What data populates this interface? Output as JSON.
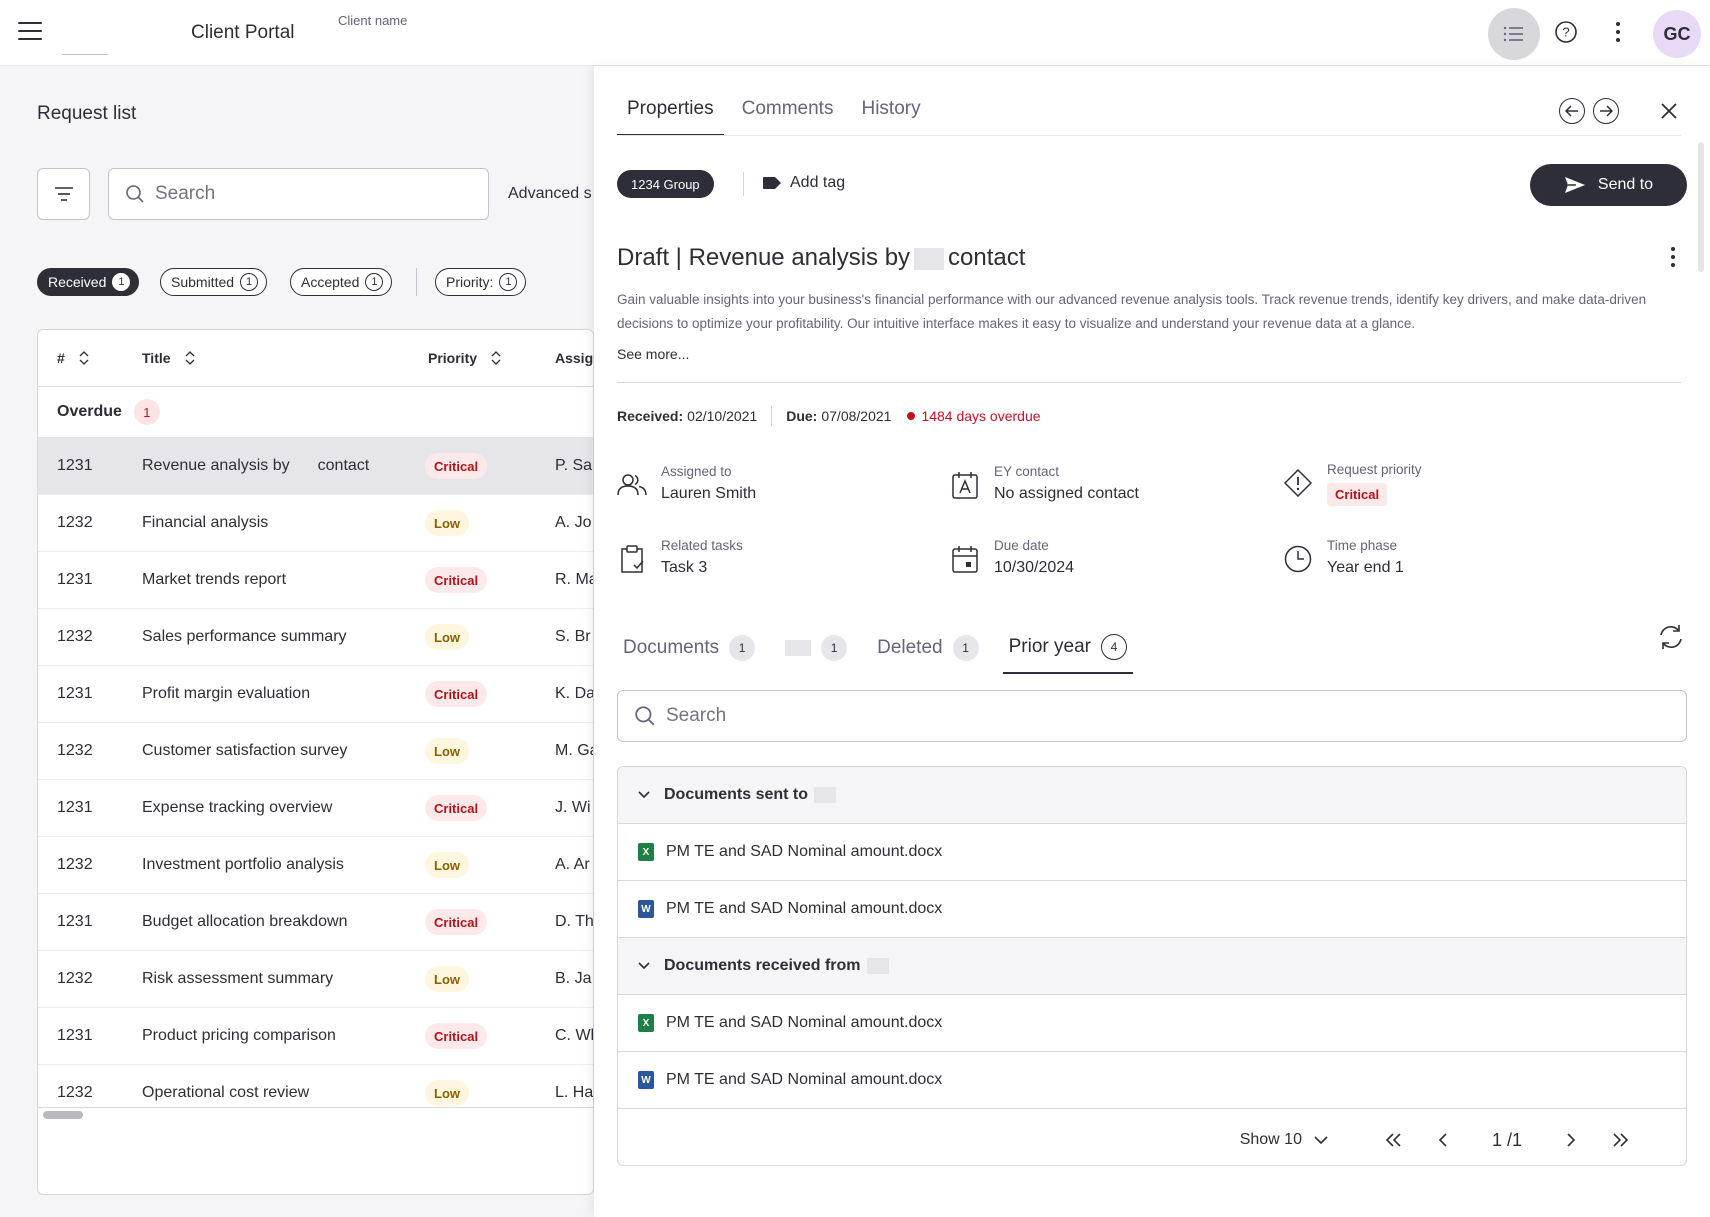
{
  "header": {
    "app_title": "Client Portal",
    "client_name": "Client name",
    "avatar_initials": "GC"
  },
  "left": {
    "title": "Request list",
    "search_placeholder": "Search",
    "advanced_search": "Advanced s",
    "chips": [
      {
        "label": "Received",
        "count": "1"
      },
      {
        "label": "Submitted",
        "count": "1"
      },
      {
        "label": "Accepted",
        "count": "1"
      },
      {
        "label": "Priority:",
        "count": "1"
      }
    ],
    "columns": {
      "num": "#",
      "title": "Title",
      "priority": "Priority",
      "assign": "Assign"
    },
    "overdue_label": "Overdue",
    "overdue_count": "1",
    "rows": [
      {
        "num": "1231",
        "title_a": "Revenue analysis by",
        "title_b": "contact",
        "priority": "Critical",
        "assignee": "P. Sa"
      },
      {
        "num": "1232",
        "title": "Financial analysis",
        "priority": "Low",
        "assignee": "A. Jo"
      },
      {
        "num": "1231",
        "title": "Market trends report",
        "priority": "Critical",
        "assignee": "R. Ma"
      },
      {
        "num": "1232",
        "title": "Sales performance summary",
        "priority": "Low",
        "assignee": "S. Br"
      },
      {
        "num": "1231",
        "title": "Profit margin evaluation",
        "priority": "Critical",
        "assignee": "K. Da"
      },
      {
        "num": "1232",
        "title": "Customer satisfaction survey",
        "priority": "Low",
        "assignee": "M. Ga"
      },
      {
        "num": "1231",
        "title": "Expense tracking overview",
        "priority": "Critical",
        "assignee": "J. Wi"
      },
      {
        "num": "1232",
        "title": "Investment portfolio analysis",
        "priority": "Low",
        "assignee": "A. Ar"
      },
      {
        "num": "1231",
        "title": "Budget allocation breakdown",
        "priority": "Critical",
        "assignee": "D. Th"
      },
      {
        "num": "1232",
        "title": "Risk assessment summary",
        "priority": "Low",
        "assignee": "B. Ja"
      },
      {
        "num": "1231",
        "title": "Product pricing comparison",
        "priority": "Critical",
        "assignee": "C. Wh"
      },
      {
        "num": "1232",
        "title": "Operational cost review",
        "priority": "Low",
        "assignee": "L. Ha"
      }
    ]
  },
  "drawer": {
    "tabs": [
      "Properties",
      "Comments",
      "History"
    ],
    "group_badge": "1234 Group",
    "add_tag": "Add tag",
    "send_to": "Send to",
    "title_a": "Draft | Revenue analysis by",
    "title_b": "contact",
    "description": "Gain valuable insights into your business's financial performance with our advanced revenue analysis tools. Track revenue trends, identify key drivers, and make data-driven decisions to optimize your profitability. Our intuitive interface makes it easy to visualize and understand your revenue data at a glance.",
    "see_more": "See more...",
    "received_label": "Received:",
    "received_date": "02/10/2021",
    "due_label": "Due:",
    "due_date": "07/08/2021",
    "overdue_text": "1484 days overdue",
    "props": {
      "assigned_to_label": "Assigned to",
      "assigned_to": "Lauren Smith",
      "ey_contact_label": "EY contact",
      "ey_contact": "No assigned contact",
      "priority_label": "Request priority",
      "priority": "Critical",
      "related_label": "Related tasks",
      "related": "Task 3",
      "due_label": "Due date",
      "due": "10/30/2024",
      "phase_label": "Time phase",
      "phase": "Year end 1"
    },
    "doc_tabs": [
      {
        "label": "Documents",
        "count": "1"
      },
      {
        "label": "",
        "count": "1"
      },
      {
        "label": "Deleted",
        "count": "1"
      },
      {
        "label": "Prior year",
        "count": "4"
      }
    ],
    "search_placeholder": "Search",
    "group_sent": "Documents sent to",
    "group_received": "Documents received from",
    "files": [
      {
        "name": "PM TE and SAD Nominal amount.docx",
        "icon": "excel-file-icon"
      },
      {
        "name": "PM TE and SAD Nominal amount.docx",
        "icon": "word-file-icon"
      },
      {
        "name": "PM TE and SAD Nominal amount.docx",
        "icon": "excel-file-icon"
      },
      {
        "name": "PM TE and SAD Nominal amount.docx",
        "icon": "word-file-icon"
      }
    ],
    "pager": {
      "show": "Show 10",
      "page": "1 /1"
    }
  },
  "colors": {
    "dark": "#2e2e38",
    "critical": "#b5121b",
    "low": "#8a6100",
    "overdue": "#c2121f"
  }
}
